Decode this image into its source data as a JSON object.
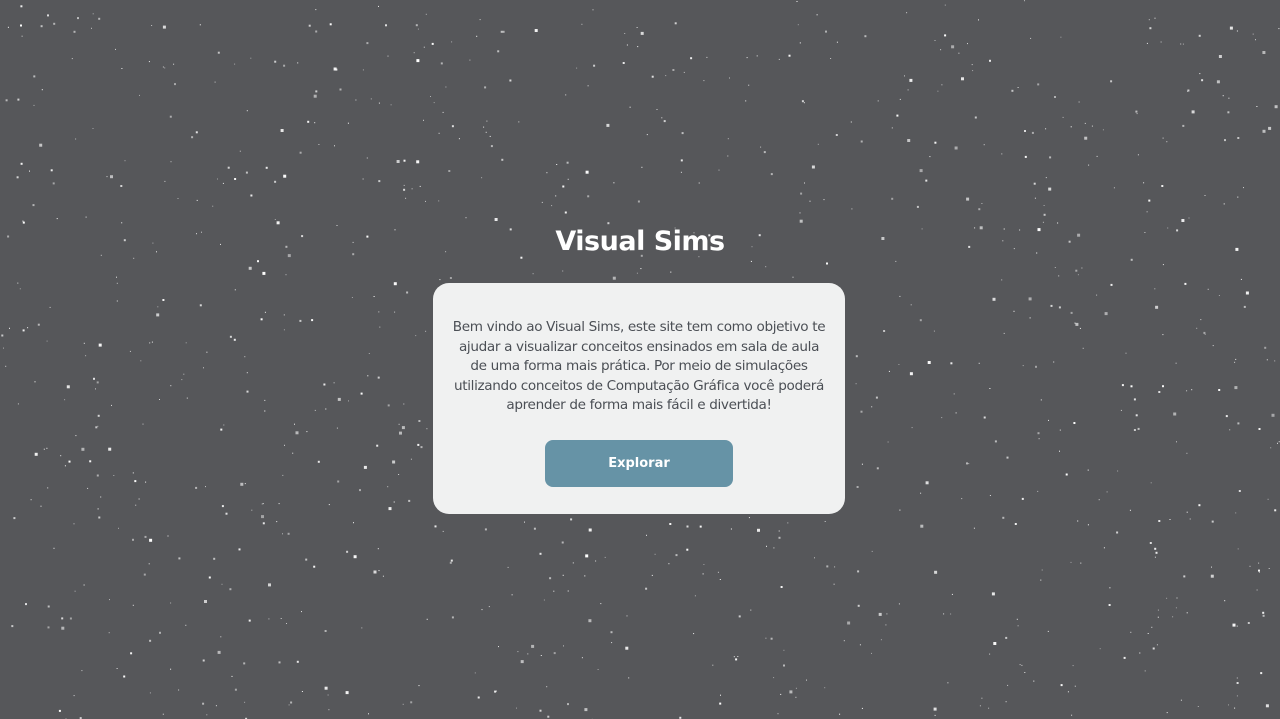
{
  "page": {
    "title": "Visual Sims",
    "description": "Bem vindo ao Visual Sims, este site tem como objetivo te ajudar a visualizar conceitos ensinados em sala de aula de uma forma mais prática. Por meio de simulações utilizando conceitos de Computação Gráfica você poderá aprender de forma mais fácil e divertida!",
    "button_label": "Explorar"
  },
  "colors": {
    "background": "#56575a",
    "card": "#f0f1f1",
    "button": "#6693a6",
    "star": "#ffffff"
  }
}
